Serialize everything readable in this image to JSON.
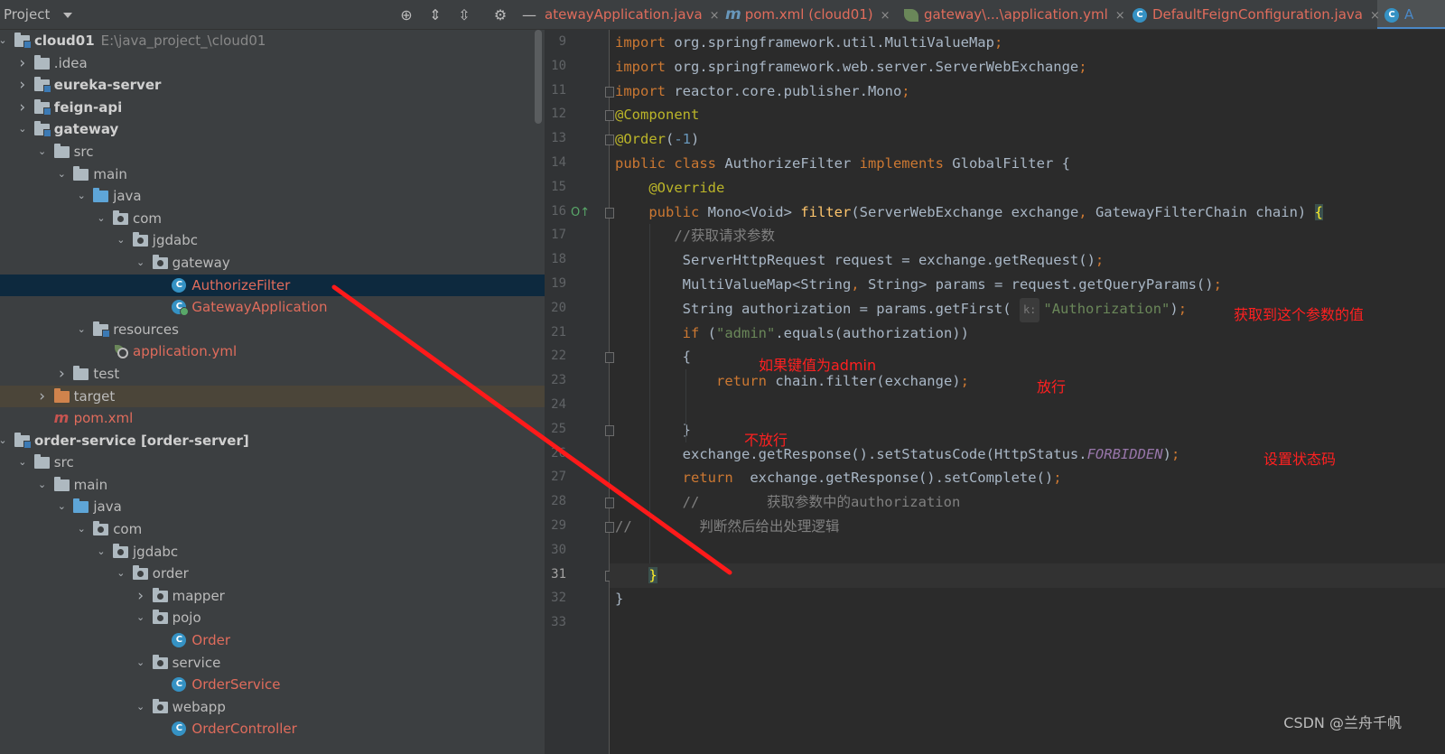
{
  "project_panel": {
    "title": "Project",
    "tree": [
      {
        "label": "cloud01",
        "suffix": "E:\\java_project_\\cloud01",
        "depth": 0,
        "arrow": "down",
        "icon": "module-folder-icon",
        "style": "bold"
      },
      {
        "label": ".idea",
        "depth": 1,
        "arrow": "right",
        "icon": "folder-icon",
        "style": ""
      },
      {
        "label": "eureka-server",
        "depth": 1,
        "arrow": "right",
        "icon": "module-folder-icon",
        "style": "bold"
      },
      {
        "label": "feign-api",
        "depth": 1,
        "arrow": "right",
        "icon": "module-folder-icon",
        "style": "bold"
      },
      {
        "label": "gateway",
        "depth": 1,
        "arrow": "down",
        "icon": "module-folder-icon",
        "style": "bold"
      },
      {
        "label": "src",
        "depth": 2,
        "arrow": "down",
        "icon": "folder-icon",
        "style": ""
      },
      {
        "label": "main",
        "depth": 3,
        "arrow": "down",
        "icon": "folder-icon",
        "style": ""
      },
      {
        "label": "java",
        "depth": 4,
        "arrow": "down",
        "icon": "source-folder-icon",
        "style": ""
      },
      {
        "label": "com",
        "depth": 5,
        "arrow": "down",
        "icon": "package-icon",
        "style": ""
      },
      {
        "label": "jgdabc",
        "depth": 6,
        "arrow": "down",
        "icon": "package-icon",
        "style": ""
      },
      {
        "label": "gateway",
        "depth": 7,
        "arrow": "down",
        "icon": "package-icon",
        "style": ""
      },
      {
        "label": "AuthorizeFilter",
        "depth": 8,
        "arrow": "",
        "icon": "class-icon",
        "style": "red",
        "selected": true
      },
      {
        "label": "GatewayApplication",
        "depth": 8,
        "arrow": "",
        "icon": "spring-boot-class-icon",
        "style": "red"
      },
      {
        "label": "resources",
        "depth": 4,
        "arrow": "down",
        "icon": "resources-folder-icon",
        "style": ""
      },
      {
        "label": "application.yml",
        "depth": 5,
        "arrow": "",
        "icon": "spring-yml-icon",
        "style": "red"
      },
      {
        "label": "test",
        "depth": 3,
        "arrow": "right",
        "icon": "folder-icon",
        "style": ""
      },
      {
        "label": "target",
        "depth": 2,
        "arrow": "right",
        "icon": "excluded-folder-icon",
        "style": "",
        "excluded": true
      },
      {
        "label": "pom.xml",
        "depth": 2,
        "arrow": "",
        "icon": "maven-icon",
        "style": "red"
      },
      {
        "label": "order-service [order-server]",
        "depth": 0,
        "arrow": "down",
        "icon": "module-folder-icon",
        "style": "bold"
      },
      {
        "label": "src",
        "depth": 1,
        "arrow": "down",
        "icon": "folder-icon",
        "style": ""
      },
      {
        "label": "main",
        "depth": 2,
        "arrow": "down",
        "icon": "folder-icon",
        "style": ""
      },
      {
        "label": "java",
        "depth": 3,
        "arrow": "down",
        "icon": "source-folder-icon",
        "style": ""
      },
      {
        "label": "com",
        "depth": 4,
        "arrow": "down",
        "icon": "package-icon",
        "style": ""
      },
      {
        "label": "jgdabc",
        "depth": 5,
        "arrow": "down",
        "icon": "package-icon",
        "style": ""
      },
      {
        "label": "order",
        "depth": 6,
        "arrow": "down",
        "icon": "package-icon",
        "style": ""
      },
      {
        "label": "mapper",
        "depth": 7,
        "arrow": "right",
        "icon": "package-icon",
        "style": ""
      },
      {
        "label": "pojo",
        "depth": 7,
        "arrow": "down",
        "icon": "package-icon",
        "style": ""
      },
      {
        "label": "Order",
        "depth": 8,
        "arrow": "",
        "icon": "class-icon",
        "style": "red"
      },
      {
        "label": "service",
        "depth": 7,
        "arrow": "down",
        "icon": "package-icon",
        "style": ""
      },
      {
        "label": "OrderService",
        "depth": 8,
        "arrow": "",
        "icon": "class-icon",
        "style": "red"
      },
      {
        "label": "webapp",
        "depth": 7,
        "arrow": "down",
        "icon": "package-icon",
        "style": ""
      },
      {
        "label": "OrderController",
        "depth": 8,
        "arrow": "",
        "icon": "class-icon",
        "style": "red"
      }
    ]
  },
  "tabs": [
    {
      "label": "atewayApplication.java",
      "icon": "none"
    },
    {
      "label": "pom.xml (cloud01)",
      "icon": "maven-icon"
    },
    {
      "label": "gateway\\...\\application.yml",
      "icon": "spring-yml-icon"
    },
    {
      "label": "DefaultFeignConfiguration.java",
      "icon": "class-icon"
    },
    {
      "label": "A",
      "icon": "class-icon",
      "active": true
    }
  ],
  "close_glyph": "×",
  "editor": {
    "current_line": 31,
    "lines": [
      {
        "n": 9,
        "html_key": "l9"
      },
      {
        "n": 10,
        "html_key": "l10"
      },
      {
        "n": 11,
        "html_key": "l11"
      },
      {
        "n": 12,
        "html_key": "l12"
      },
      {
        "n": 13,
        "html_key": "l13"
      },
      {
        "n": 14,
        "html_key": "l14"
      },
      {
        "n": 15,
        "html_key": "l15"
      },
      {
        "n": 16,
        "html_key": "l16"
      },
      {
        "n": 17,
        "html_key": "l17"
      },
      {
        "n": 18,
        "html_key": "l18"
      },
      {
        "n": 19,
        "html_key": "l19"
      },
      {
        "n": 20,
        "html_key": "l20"
      },
      {
        "n": 21,
        "html_key": "l21"
      },
      {
        "n": 22,
        "html_key": "l22"
      },
      {
        "n": 23,
        "html_key": "l23"
      },
      {
        "n": 24,
        "html_key": "l24"
      },
      {
        "n": 25,
        "html_key": "l25"
      },
      {
        "n": 26,
        "html_key": "l26"
      },
      {
        "n": 27,
        "html_key": "l27"
      },
      {
        "n": 28,
        "html_key": "l28"
      },
      {
        "n": 29,
        "html_key": "l29"
      },
      {
        "n": 30,
        "html_key": "l30"
      },
      {
        "n": 31,
        "html_key": "l31"
      },
      {
        "n": 32,
        "html_key": "l32"
      },
      {
        "n": 33,
        "html_key": "l33"
      }
    ],
    "code": {
      "l9": [
        [
          "kw",
          "import "
        ],
        [
          "",
          "org.springframework.util.MultiValueMap"
        ],
        [
          "kw",
          ";"
        ]
      ],
      "l10": [
        [
          "kw",
          "import "
        ],
        [
          "",
          "org.springframework.web.server.ServerWebExchange"
        ],
        [
          "kw",
          ";"
        ]
      ],
      "l11": [
        [
          "kw",
          "import "
        ],
        [
          "",
          "reactor.core.publisher.Mono"
        ],
        [
          "kw",
          ";"
        ]
      ],
      "l12": [
        [
          "ann",
          "@Component"
        ]
      ],
      "l13": [
        [
          "ann",
          "@Order"
        ],
        [
          "",
          "("
        ],
        [
          "num",
          "-1"
        ],
        [
          "",
          ")"
        ]
      ],
      "l14": [
        [
          "kw",
          "public class "
        ],
        [
          "",
          "AuthorizeFilter "
        ],
        [
          "kw",
          "implements "
        ],
        [
          "",
          "GlobalFilter {"
        ]
      ],
      "l15": [
        [
          "",
          "    "
        ],
        [
          "ann",
          "@Override"
        ]
      ],
      "l16": [
        [
          "",
          "    "
        ],
        [
          "kw",
          "public "
        ],
        [
          "",
          "Mono<Void> "
        ],
        [
          "fn",
          "filter"
        ],
        [
          "",
          "(ServerWebExchange exchange"
        ],
        [
          "kw",
          ", "
        ],
        [
          "",
          "GatewayFilterChain chain) "
        ],
        [
          "brace",
          "{"
        ]
      ],
      "l17": [
        [
          "",
          "       "
        ],
        [
          "cm",
          "//获取请求参数"
        ]
      ],
      "l18": [
        [
          "",
          "        ServerHttpRequest request = exchange.getRequest()"
        ],
        [
          "kw",
          ";"
        ]
      ],
      "l19": [
        [
          "",
          "        MultiValueMap<String"
        ],
        [
          "kw",
          ", "
        ],
        [
          "",
          "String> params = request.getQueryParams()"
        ],
        [
          "kw",
          ";"
        ]
      ],
      "l20": [
        [
          "",
          "        String authorization = params.getFirst( "
        ],
        [
          "hint",
          "k:"
        ],
        [
          "str",
          "\"Authorization\""
        ],
        [
          "",
          ")"
        ],
        [
          "kw",
          ";"
        ]
      ],
      "l21": [
        [
          "",
          "        "
        ],
        [
          "kw",
          "if "
        ],
        [
          "",
          "("
        ],
        [
          "str",
          "\"admin\""
        ],
        [
          "",
          ".equals(authorization))"
        ]
      ],
      "l22": [
        [
          "",
          "        {"
        ]
      ],
      "l23": [
        [
          "",
          "            "
        ],
        [
          "kw",
          "return "
        ],
        [
          "",
          "chain.filter(exchange)"
        ],
        [
          "kw",
          ";"
        ]
      ],
      "l24": [
        [
          "",
          ""
        ]
      ],
      "l25": [
        [
          "",
          "        }"
        ]
      ],
      "l26": [
        [
          "",
          "        exchange.getResponse().setStatusCode(HttpStatus."
        ],
        [
          "cst",
          "FORBIDDEN"
        ],
        [
          "",
          ")"
        ],
        [
          "kw",
          ";"
        ]
      ],
      "l27": [
        [
          "",
          "        "
        ],
        [
          "kw",
          "return  "
        ],
        [
          "",
          "exchange.getResponse().setComplete()"
        ],
        [
          "kw",
          ";"
        ]
      ],
      "l28": [
        [
          "",
          "        "
        ],
        [
          "cm",
          "//        获取参数中的authorization"
        ]
      ],
      "l29": [
        [
          "cm",
          "//        判断然后给出处理逻辑"
        ]
      ],
      "l30": [
        [
          "",
          ""
        ]
      ],
      "l31": [
        [
          "",
          "    "
        ],
        [
          "brace",
          "}"
        ]
      ],
      "l32": [
        [
          "",
          "}"
        ]
      ],
      "l33": [
        [
          "",
          ""
        ]
      ]
    }
  },
  "annotations": {
    "get_param": "获取到这个参数的值",
    "if_admin": "如果键值为admin",
    "pass": "放行",
    "not_pass": "不放行",
    "set_status": "设置状态码"
  },
  "watermark": "CSDN @兰舟千帆",
  "colors": {
    "annotation_red": "#ff2020",
    "selection": "#0d293e"
  }
}
